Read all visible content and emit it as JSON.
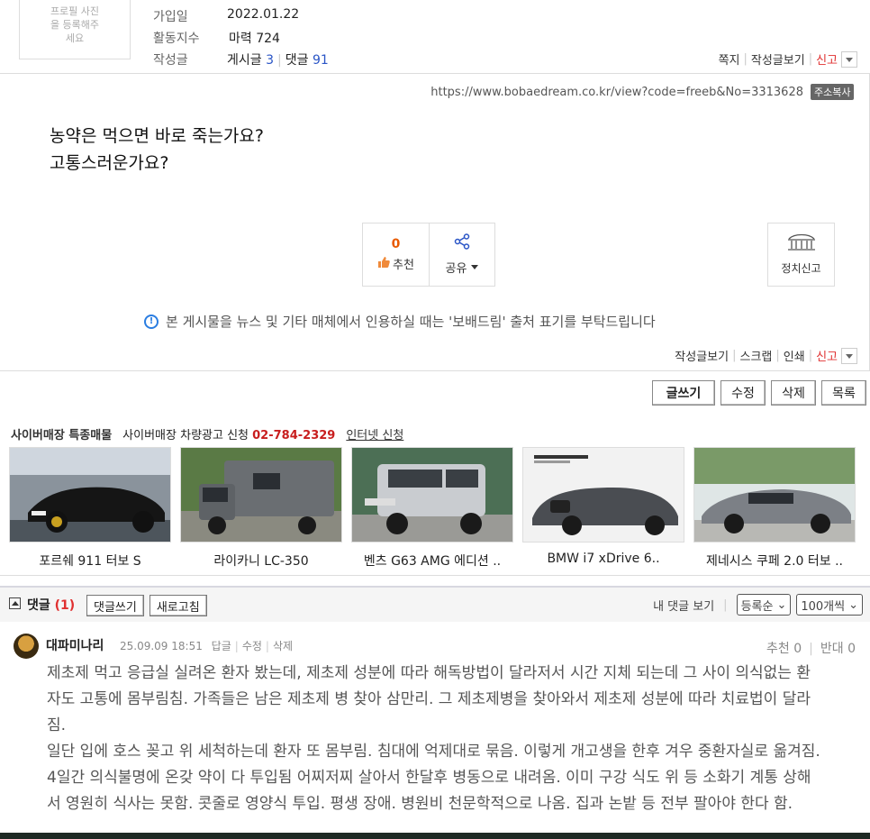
{
  "profile": {
    "photo_text": "프로필 사진을 등록해주세요",
    "joined_label": "가입일",
    "joined_value": "2022.01.22",
    "activity_label": "활동지수",
    "activity_value": "마력 724",
    "posts_label": "작성글",
    "posts_name": "게시글",
    "posts_count": "3",
    "comments_name": "댓글",
    "comments_count": "91",
    "actions": [
      "쪽지",
      "작성글보기",
      "신고"
    ]
  },
  "post": {
    "url": "https://www.bobaedream.co.kr/view?code=freeb&No=3313628",
    "copy_label": "주소복사",
    "lines": [
      "농약은 먹으면 바로 죽는가요?",
      "고통스러운가요?"
    ],
    "recommend_count": "0",
    "recommend_label": "추천",
    "share_label": "공유",
    "politic_label": "정치신고",
    "notice": "본 게시물을 뉴스 및 기타 매체에서 인용하실 때는 '보배드림' 출처 표기를 부탁드립니다",
    "bottom_actions": [
      "작성글보기",
      "스크랩",
      "인쇄",
      "신고"
    ]
  },
  "buttons": {
    "write": "글쓰기",
    "edit": "수정",
    "delete": "삭제",
    "list": "목록"
  },
  "market": {
    "title": "사이버매장 특종매물",
    "ad_label": "사이버매장 차량광고 신청",
    "phone": "02-784-2329",
    "apply": "인터넷 신청",
    "cars": [
      {
        "name": "포르쉐 911 터보 S"
      },
      {
        "name": "라이카니 LC-350"
      },
      {
        "name": "벤츠 G63 AMG 에디션 .."
      },
      {
        "name": "BMW i7 xDrive 6.."
      },
      {
        "name": "제네시스 쿠페 2.0 터보 .."
      }
    ]
  },
  "comments": {
    "title": "댓글",
    "count": "(1)",
    "write_btn": "댓글쓰기",
    "refresh_btn": "새로고침",
    "my_comments": "내 댓글 보기",
    "sort_value": "등록순",
    "per_page_value": "100개씩",
    "items": [
      {
        "author": "대파미나리",
        "date": "25.09.09 18:51",
        "actions": [
          "답글",
          "수정",
          "삭제"
        ],
        "up": "추천 0",
        "down": "반대 0",
        "paragraphs": [
          "제초제 먹고 응급실 실려온 환자 봤는데, 제초제 성분에 따라 해독방법이 달라저서 시간 지체 되는데 그 사이 의식없는 환자도 고통에 몸부림침. 가족들은 남은 제초제 병 찾아 삼만리. 그 제초제병을 찾아와서 제초제 성분에 따라 치료법이 달라짐.",
          "일단 입에 호스 꽂고 위 세척하는데 환자 또 몸부림. 침대에 억제대로 묶음. 이렇게 개고생을 한후 겨우 중환자실로 옮겨짐. 4일간 의식불명에 온갖 약이 다 투입됨 어찌저찌 살아서 한달후 병동으로 내려옴. 이미 구강 식도 위 등 소화기 계통 상해서 영원히 식사는 못함. 콧줄로 영양식 투입. 평생 장애. 병원비 천문학적으로 나옴. 집과 논밭 등 전부 팔아야 한다 함."
        ]
      }
    ]
  },
  "colors": {
    "accent_red": "#e03030",
    "link_blue": "#2a55c6",
    "recommend_orange": "#e85a00"
  }
}
